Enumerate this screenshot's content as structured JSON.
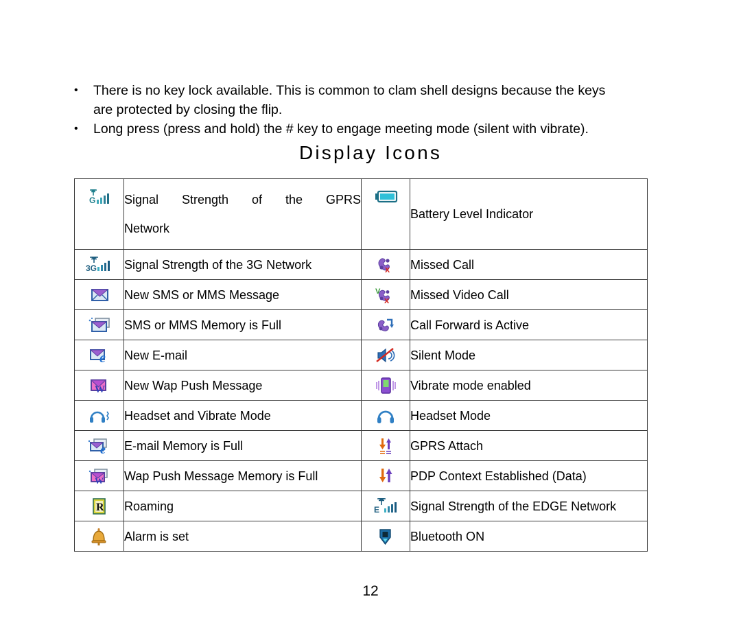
{
  "bullets": [
    {
      "marker": "•",
      "line1": "There is no key lock available. This is common to clam shell designs because the keys",
      "line2": "are protected by closing the flip."
    },
    {
      "marker": "•",
      "line1": "Long press (press and hold) the # key to engage meeting mode (silent with vibrate).",
      "line2": ""
    }
  ],
  "heading": "Display Icons",
  "table": {
    "rows": [
      {
        "left": {
          "icon": "gprs-signal-icon",
          "label_line1": "Signal Strength of the GPRS",
          "label_line2": "Network",
          "justified": true
        },
        "right": {
          "icon": "battery-icon",
          "label": "Battery Level Indicator"
        },
        "tall": true
      },
      {
        "left": {
          "icon": "3g-signal-icon",
          "label": "Signal Strength of the 3G Network"
        },
        "right": {
          "icon": "missed-call-icon",
          "label": "Missed Call"
        }
      },
      {
        "left": {
          "icon": "new-sms-icon",
          "label": "New SMS or MMS Message"
        },
        "right": {
          "icon": "missed-video-call-icon",
          "label": "Missed Video Call"
        }
      },
      {
        "left": {
          "icon": "sms-memory-full-icon",
          "label": "SMS or MMS Memory is Full"
        },
        "right": {
          "icon": "call-forward-icon",
          "label": "Call Forward is Active"
        }
      },
      {
        "left": {
          "icon": "new-email-icon",
          "label": "New E-mail"
        },
        "right": {
          "icon": "silent-mode-icon",
          "label": "Silent Mode"
        }
      },
      {
        "left": {
          "icon": "new-wap-push-icon",
          "label": "New Wap Push Message"
        },
        "right": {
          "icon": "vibrate-mode-icon",
          "label": "Vibrate mode enabled"
        }
      },
      {
        "left": {
          "icon": "headset-vibrate-icon",
          "label": "Headset and Vibrate Mode"
        },
        "right": {
          "icon": "headset-icon",
          "label": "Headset Mode"
        }
      },
      {
        "left": {
          "icon": "email-memory-full-icon",
          "label": "E-mail Memory is Full"
        },
        "right": {
          "icon": "gprs-attach-icon",
          "label": "GPRS Attach"
        }
      },
      {
        "left": {
          "icon": "wap-memory-full-icon",
          "label": "Wap Push Message Memory is Full"
        },
        "right": {
          "icon": "pdp-context-icon",
          "label": "PDP Context Established (Data)"
        }
      },
      {
        "left": {
          "icon": "roaming-icon",
          "label": "Roaming"
        },
        "right": {
          "icon": "edge-signal-icon",
          "label": "Signal Strength of the EDGE Network"
        }
      },
      {
        "left": {
          "icon": "alarm-icon",
          "label": "Alarm is set"
        },
        "right": {
          "icon": "bluetooth-icon",
          "label": "Bluetooth ON"
        }
      }
    ]
  },
  "page_number": "12",
  "colors": {
    "signal_teal": "#1f7f8c",
    "signal_bar": "#2e8fa3",
    "battery_cyan": "#26b3cf",
    "envelope_blue": "#3a6fb8",
    "envelope_purple": "#8b4fc0",
    "handset_purple": "#7b4bbd",
    "missed_red": "#d42a22",
    "wap_pink": "#e04ab0",
    "headset_blue": "#2f7fc4",
    "vibrate_purple": "#7b3fbd",
    "arrow_orange": "#e06a10",
    "arrow_purple": "#6b3fbd",
    "roaming_yellow": "#d9d43a",
    "alarm_gold": "#d9952a",
    "bluetooth_blue": "#1c6ea8",
    "border": "#3a3a3a"
  }
}
